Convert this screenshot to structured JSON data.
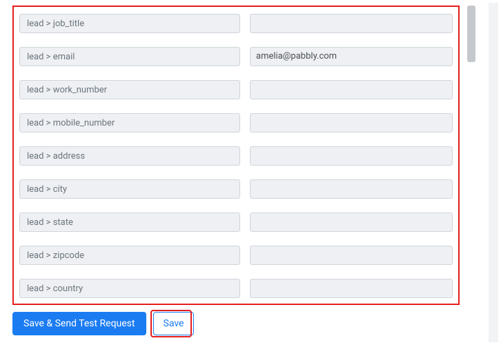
{
  "fields": [
    {
      "label": "lead > job_title",
      "value": ""
    },
    {
      "label": "lead > email",
      "value": "amelia@pabbly.com"
    },
    {
      "label": "lead > work_number",
      "value": ""
    },
    {
      "label": "lead > mobile_number",
      "value": ""
    },
    {
      "label": "lead > address",
      "value": ""
    },
    {
      "label": "lead > city",
      "value": ""
    },
    {
      "label": "lead > state",
      "value": ""
    },
    {
      "label": "lead > zipcode",
      "value": ""
    },
    {
      "label": "lead > country",
      "value": ""
    }
  ],
  "buttons": {
    "save_send": "Save & Send Test Request",
    "save": "Save"
  },
  "highlight_color": "#e41c1c",
  "primary_color": "#1b7cf2"
}
